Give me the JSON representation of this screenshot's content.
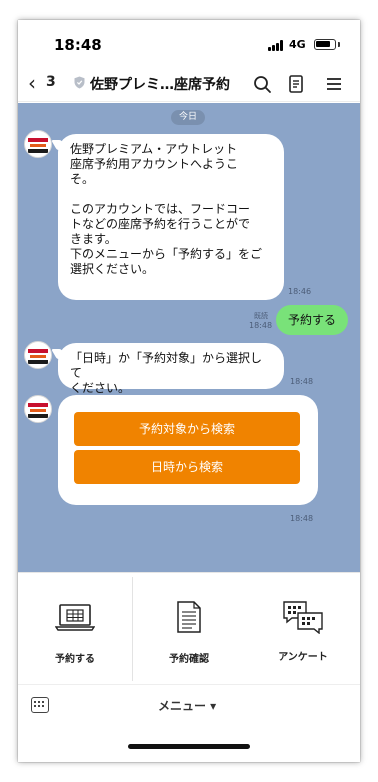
{
  "status_bar": {
    "time": "18:48",
    "network": "4G",
    "battery_level": 0.8
  },
  "header": {
    "back_count": "3",
    "title": "佐野プレミ…座席予約",
    "icons": [
      "search-icon",
      "notes-icon",
      "menu-icon"
    ]
  },
  "chat": {
    "date_label": "今日",
    "messages": [
      {
        "sender": "bot",
        "text": "佐野プレミアム・アウトレット\n座席予約用アカウントへようこ\nそ。\n\nこのアカウントでは、フードコー\nトなどの座席予約を行うことがで\nきます。\n下のメニューから「予約する」をご\n選択ください。",
        "time": "18:46"
      },
      {
        "sender": "user",
        "text": "予約する",
        "time": "18:48",
        "read": "既読"
      },
      {
        "sender": "bot",
        "text": "「日時」か「予約対象」から選択して\nください。",
        "time": "18:48"
      },
      {
        "sender": "bot",
        "buttons": [
          "予約対象から検索",
          "日時から検索"
        ],
        "time": "18:48"
      }
    ]
  },
  "rich_menu": {
    "items": [
      {
        "label": "予約する",
        "icon": "laptop-icon"
      },
      {
        "label": "予約確認",
        "icon": "document-icon"
      },
      {
        "label": "アンケート",
        "icon": "chat-bubbles-icon"
      }
    ]
  },
  "menu_bar": {
    "label": "メニュー ▾"
  },
  "colors": {
    "chat_background": "#8ba4c8",
    "button_orange": "#f08300",
    "user_bubble": "#79e279"
  }
}
